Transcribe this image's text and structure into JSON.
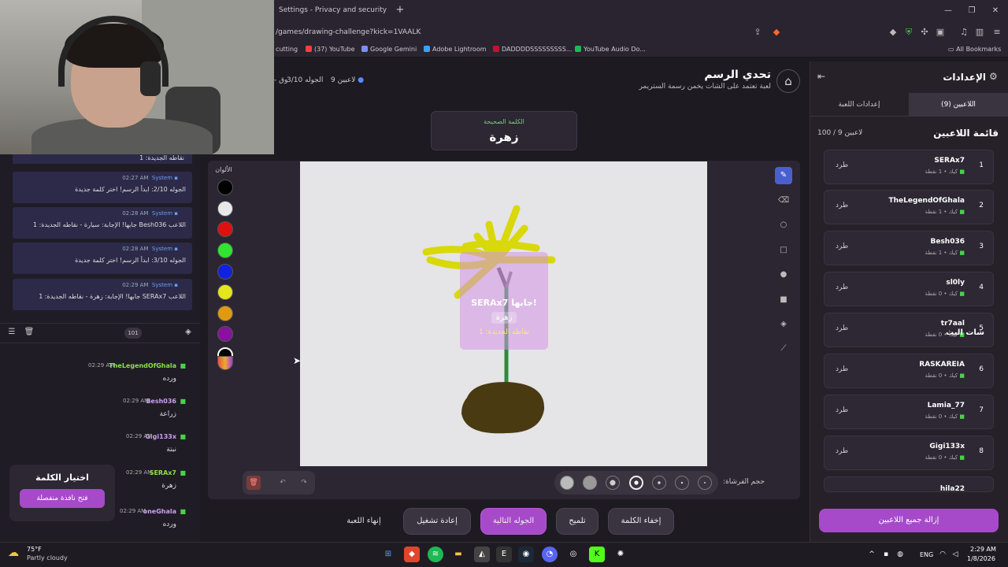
{
  "browser": {
    "tab_title": "Settings - Privacy and security",
    "url": "/games/drawing-challenge?kick=1VAALK",
    "bookmarks": [
      "cutting",
      "(37) YouTube",
      "Google Gemini",
      "Adobe Lightroom",
      "DADDDDSSSSSSSSS...",
      "YouTube Audio Do..."
    ],
    "all_bookmarks": "All Bookmarks",
    "colors": {
      "yt": "#ff3d3d",
      "gemini": "#7b8cff",
      "lr": "#3aa0ff",
      "dad": "#c8102e",
      "ytaudio": "#1db954"
    }
  },
  "header": {
    "title": "تحدي الرسم",
    "subtitle": "لعبة تعتمد على الشات يخمن رسمة الستريمر",
    "players_count": "9 لاعبين",
    "round": "الجوله 3/10",
    "extra": "- وق"
  },
  "word": {
    "label": "الكلمة الصحيحة",
    "value": "زهرة"
  },
  "colors_panel": {
    "label": "الألوان",
    "swatches": [
      "#000000",
      "#e8e8e8",
      "#e01010",
      "#2fe52f",
      "#1022e0",
      "#e5e51e",
      "#e09a10",
      "#8a10a0",
      "#000000"
    ]
  },
  "overlay": {
    "line1": "SERAx7 جابها!",
    "line2": "زهرة",
    "line3": "نقاطه الجديدة: 1"
  },
  "brush": {
    "label": "حجم الفرشاة:"
  },
  "buttons": {
    "hide_word": "إخفاء الكلمة",
    "hint": "تلميح",
    "next_round": "الجوله التالية",
    "replay": "إعادة تشغيل",
    "end_game": "إنهاء اللعبة"
  },
  "settings_panel": {
    "title": "الإعدادات",
    "tab_players": "اللاعبين (9)",
    "tab_game_settings": "إعدادات اللعبة",
    "list_title": "قائمة اللاعبين",
    "list_count": "100 / 9 لاعبين",
    "kick_label": "طرد",
    "remove_all": "إزالة جميع اللاعبين",
    "players": [
      {
        "index": "1",
        "name": "SERAx7",
        "points": "كيك • 1 نقطة"
      },
      {
        "index": "2",
        "name": "TheLegendOfGhala",
        "points": "كيك • 1 نقطة"
      },
      {
        "index": "3",
        "name": "Besh036",
        "points": "كيك • 1 نقطة"
      },
      {
        "index": "4",
        "name": "sl0ly",
        "points": "كيك • 0 نقطة"
      },
      {
        "index": "5",
        "name": "tr7aal",
        "points": "كيك • 0 نقطة"
      },
      {
        "index": "6",
        "name": "RASKAREIA",
        "points": "كيك • 0 نقطة"
      },
      {
        "index": "7",
        "name": "Lamia_77",
        "points": "كيك • 0 نقطة"
      },
      {
        "index": "8",
        "name": "Gigi133x",
        "points": "كيك • 0 نقطة"
      },
      {
        "index": "",
        "name": "hila22",
        "points": ""
      }
    ]
  },
  "system_messages": [
    {
      "sender": "System",
      "time": "02:27 AM",
      "text": "الجوله 2/10: ابدأ الرسم! اختر كلمة جديدة"
    },
    {
      "sender": "System",
      "time": "02:28 AM",
      "text": "اللاعب Besh036 جابها! الإجابة: سيارة - نقاطه الجديدة: 1"
    },
    {
      "sender": "System",
      "time": "02:28 AM",
      "text": "الجوله 3/10: ابدأ الرسم! اختر كلمة جديدة"
    },
    {
      "sender": "System",
      "time": "02:29 AM",
      "text": "اللاعب SERAx7 جابها! الإجابة: زهرة - نقاطه الجديدة: 1"
    }
  ],
  "sys_top_partial": "نقاطه الجديدة: 1",
  "chat": {
    "title": "شات البث",
    "count": "101",
    "messages": [
      {
        "name": "TheLegendOfGhala",
        "time": "02:29 AM",
        "text": "ورده",
        "color": "#8be04a"
      },
      {
        "name": "Besh036",
        "time": "02:29 AM",
        "text": "زراعة",
        "color": "#c8a0f0"
      },
      {
        "name": "Gigi133x",
        "time": "02:29 AM",
        "text": "نبتة",
        "color": "#c8a0f0"
      },
      {
        "name": "SERAx7",
        "time": "02:29 AM",
        "text": "زهرة",
        "color": "#8be04a"
      },
      {
        "name": "oneGhala",
        "time": "02:29 AM",
        "text": "ورده",
        "color": "#c8a0f0"
      }
    ]
  },
  "pick_word": {
    "title": "اختيار الكلمة",
    "button": "فتح نافذة منفصلة"
  },
  "taskbar": {
    "temp": "75°F",
    "weather": "Partly cloudy",
    "lang": "ENG",
    "time": "2:29 AM",
    "date": "1/8/2026"
  }
}
